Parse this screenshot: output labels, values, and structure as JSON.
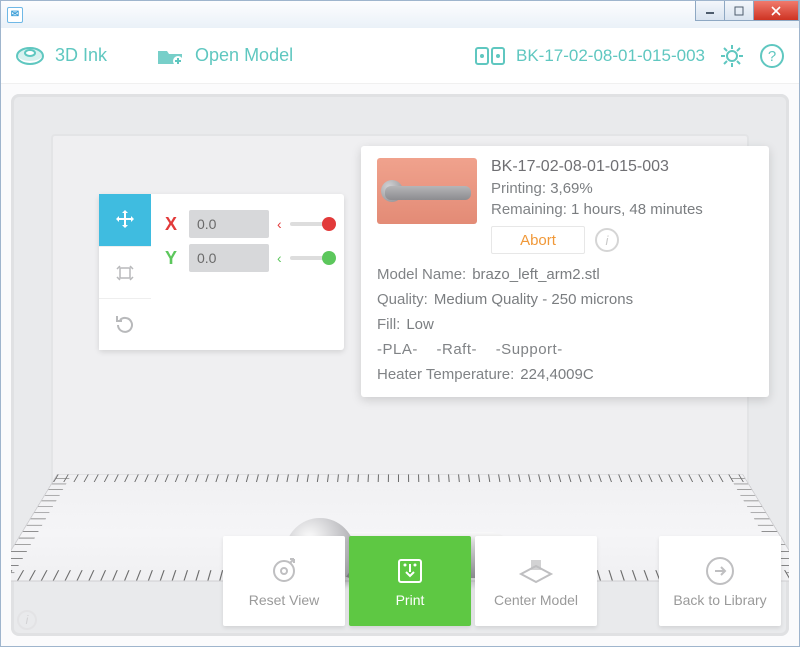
{
  "window": {
    "title": ""
  },
  "toolbar": {
    "ink_label": "3D Ink",
    "open_label": "Open Model",
    "printer_name": "BK-17-02-08-01-015-003"
  },
  "transform": {
    "x_label": "X",
    "y_label": "Y",
    "x_value": "0.0",
    "y_value": "0.0"
  },
  "status": {
    "title": "BK-17-02-08-01-015-003",
    "printing_label": "Printing:",
    "printing_value": "3,69%",
    "remaining_label": "Remaining:",
    "remaining_value": "1 hours, 48 minutes",
    "abort_label": "Abort",
    "model_label": "Model Name:",
    "model_value": "brazo_left_arm2.stl",
    "quality_label": "Quality:",
    "quality_value": "Medium Quality - 250 microns",
    "fill_label": "Fill:",
    "fill_value": "Low",
    "tags": [
      "-PLA-",
      "-Raft-",
      "-Support-"
    ],
    "heater_label": "Heater Temperature:",
    "heater_value": "224,4009C"
  },
  "bottom": {
    "reset_label": "Reset View",
    "print_label": "Print",
    "center_label": "Center Model",
    "library_label": "Back to Library"
  }
}
